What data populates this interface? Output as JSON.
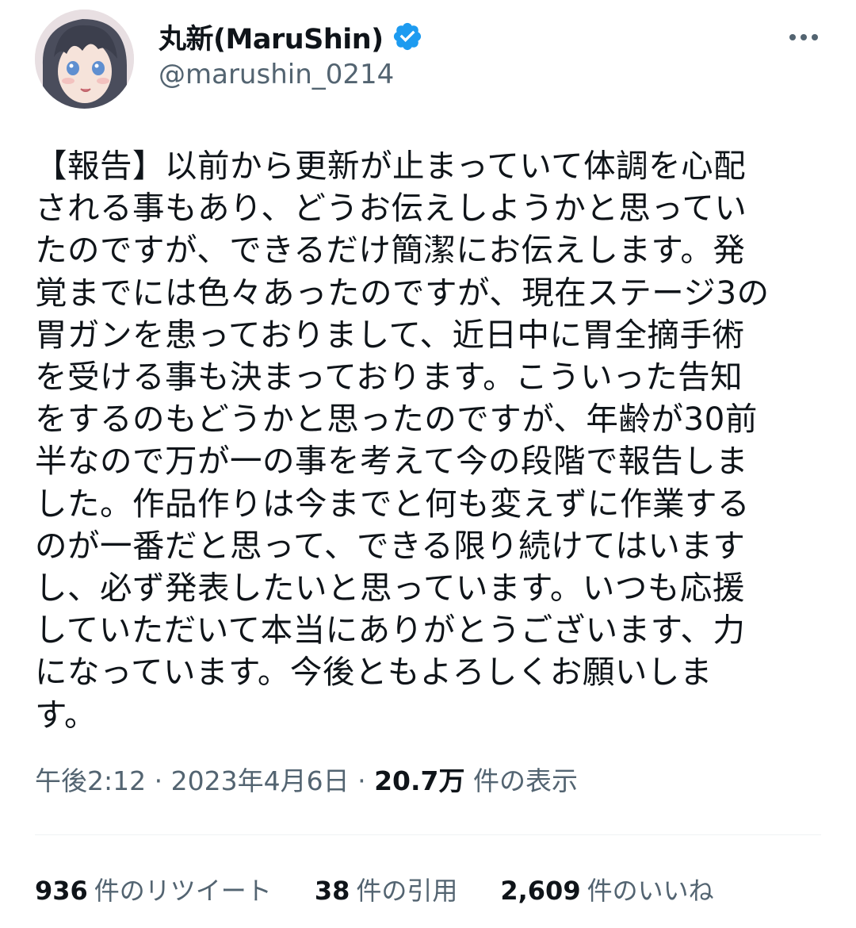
{
  "tweet": {
    "author": {
      "display_name": "丸新(MaruShin)",
      "handle": "@marushin_0214",
      "verified": true
    },
    "body": "【報告】以前から更新が止まっていて体調を心配\nされる事もあり、どうお伝えしようかと思ってい\nたのですが、できるだけ簡潔にお伝えします。発\n覚までには色々あったのですが、現在ステージ3の\n胃ガンを患っておりまして、近日中に胃全摘手術\nを受ける事も決まっております。こういった告知\nをするのもどうかと思ったのですが、年齢が30前\n半なので万が一の事を考えて今の段階で報告しま\nした。作品作りは今までと何も変えずに作業する\nのが一番だと思って、できる限り続けてはいます\nし、必ず発表したいと思っています。いつも応援\nしていただいて本当にありがとうございます、力\nになっています。今後ともよろしくお願いしま\nす。",
    "time": "午後2:12",
    "separator": "·",
    "date": "2023年4月6日",
    "views_count": "20.7万",
    "views_label": "件の表示"
  },
  "stats": {
    "retweets_count": "936",
    "retweets_label": "件のリツイート",
    "quotes_count": "38",
    "quotes_label": "件の引用",
    "likes_count": "2,609",
    "likes_label": "件のいいね"
  },
  "icons": {
    "verified": "verified-badge-icon",
    "more": "more-options-icon"
  },
  "colors": {
    "text_primary": "#0f1419",
    "text_secondary": "#536471",
    "verified_blue": "#1d9bf0",
    "divider": "#eff3f4"
  }
}
